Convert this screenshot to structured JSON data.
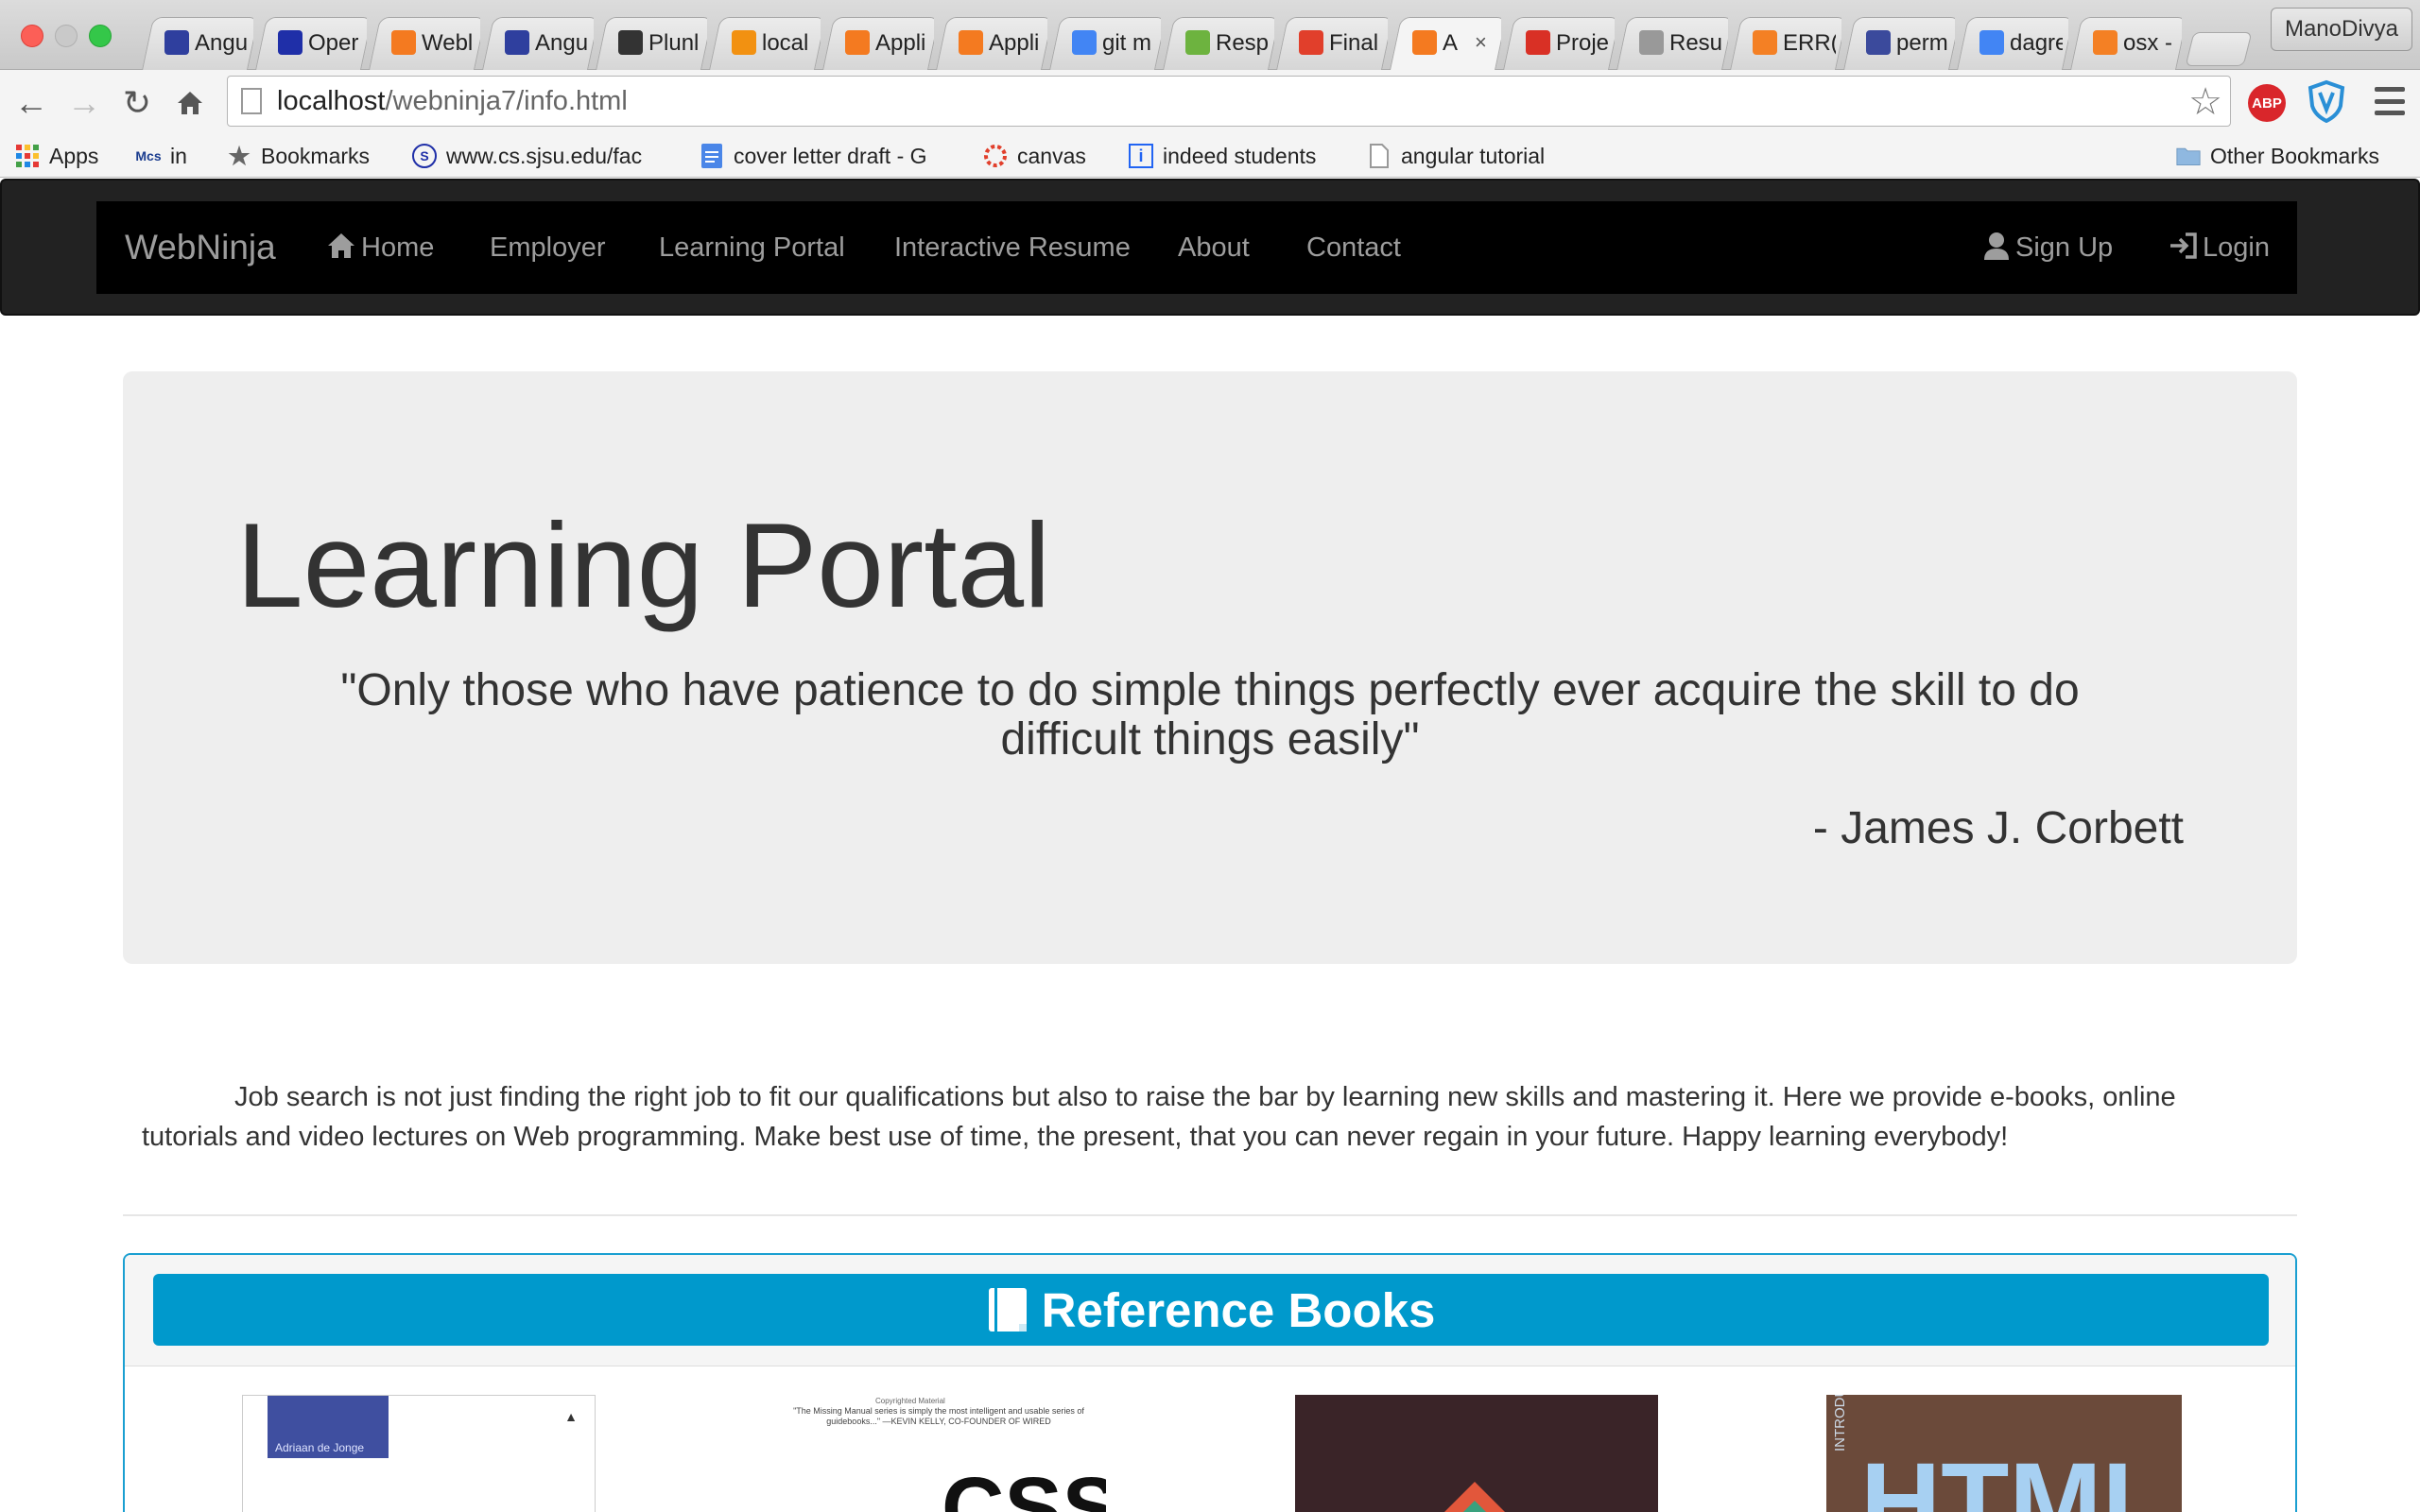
{
  "browser": {
    "tabs": [
      {
        "label": "Angu",
        "icon": "angular-shield-icon",
        "color": "#2f3f9e"
      },
      {
        "label": "Oper",
        "icon": "sjsu-icon",
        "color": "#1f2fa8"
      },
      {
        "label": "Webl",
        "icon": "xampp-icon",
        "color": "#f47a20"
      },
      {
        "label": "Angu",
        "icon": "angular-shield-icon",
        "color": "#2f3f9e"
      },
      {
        "label": "Plunl",
        "icon": "download-icon",
        "color": "#333333"
      },
      {
        "label": "local",
        "icon": "phpmyadmin-icon",
        "color": "#f29111"
      },
      {
        "label": "Appli",
        "icon": "xampp-icon",
        "color": "#f47a20"
      },
      {
        "label": "Appli",
        "icon": "xampp-icon",
        "color": "#f47a20"
      },
      {
        "label": "git m",
        "icon": "google-icon",
        "color": "#4285f4"
      },
      {
        "label": "Resp",
        "icon": "respond-icon",
        "color": "#6db33f"
      },
      {
        "label": "Final",
        "icon": "canvas-icon",
        "color": "#e13f2b"
      },
      {
        "label": "A",
        "icon": "xampp-icon",
        "color": "#f47a20",
        "active": true,
        "close": "×"
      },
      {
        "label": "Proje",
        "icon": "gmail-icon",
        "color": "#d93025"
      },
      {
        "label": "Resu",
        "icon": "page-icon",
        "color": "#999999"
      },
      {
        "label": "ERR(",
        "icon": "stackoverflow-icon",
        "color": "#f48024"
      },
      {
        "label": "perm",
        "icon": "ul-icon",
        "color": "#3b4a9c"
      },
      {
        "label": "dagre",
        "icon": "google-icon",
        "color": "#4285f4"
      },
      {
        "label": "osx -",
        "icon": "stackoverflow-icon",
        "color": "#f48024"
      }
    ],
    "profile_name": "ManoDivya",
    "url_host": "localhost",
    "url_path": "/webninja7/info.html",
    "bookmarks": [
      {
        "label": "Apps",
        "icon": "apps-grid-icon"
      },
      {
        "label": "in",
        "icon": "mcs-icon"
      },
      {
        "label": "Bookmarks",
        "icon": "star-icon"
      },
      {
        "label": "www.cs.sjsu.edu/fac",
        "icon": "sjsu-icon"
      },
      {
        "label": "cover letter draft - G",
        "icon": "docs-icon"
      },
      {
        "label": "canvas",
        "icon": "canvas-icon"
      },
      {
        "label": "indeed students",
        "icon": "indeed-icon"
      },
      {
        "label": "angular tutorial",
        "icon": "page-icon"
      }
    ],
    "other_bookmarks": "Other Bookmarks",
    "abp_label": "ABP"
  },
  "navbar": {
    "brand": "WebNinja",
    "items": [
      "Home",
      "Employer",
      "Learning Portal",
      "Interactive Resume",
      "About",
      "Contact"
    ],
    "signup": "Sign Up",
    "login": "Login"
  },
  "jumbotron": {
    "title": "Learning Portal",
    "quote": "\"Only those who have patience to do simple things perfectly ever acquire the skill to do difficult things easily\"",
    "author": "- James J. Corbett"
  },
  "intro": "Job search is not just finding the right job to fit our qualifications but also to raise the bar by learning new skills and mastering it. Here we provide e-books, online tutorials and video lectures on Web programming. Make best use of time, the present, that you can never regain in your future. Happy learning everybody!",
  "books": {
    "header": "Reference Books",
    "items": [
      {
        "author": "Adriaan de Jonge",
        "title": ""
      },
      {
        "blurb": "\"The Missing Manual series is simply the most intelligent and usable series of guidebooks...\" —KEVIN KELLY, CO-FOUNDER OF WIRED",
        "copyright": "Copyrighted Material",
        "title": "CSS"
      },
      {
        "title": ""
      },
      {
        "spine": "INTRODUCING",
        "title": "HTML"
      }
    ]
  },
  "colors": {
    "navbar_bg": "#000000",
    "jumbotron_bg": "#eeeeee",
    "books_header_bg": "#0099cc",
    "panel_border": "#1a9fd1"
  }
}
